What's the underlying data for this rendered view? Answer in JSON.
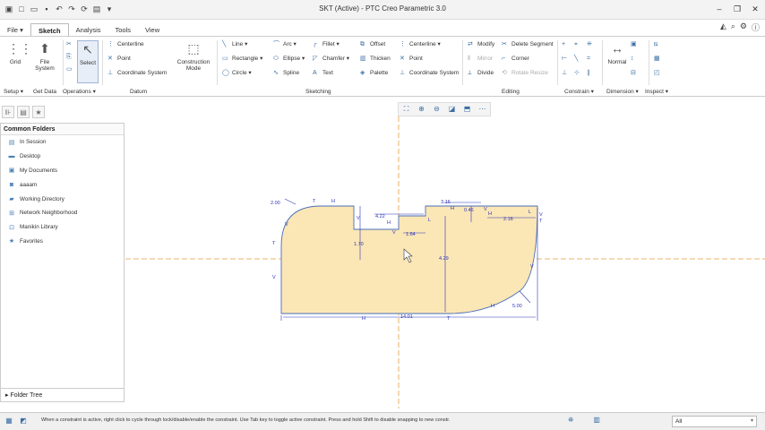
{
  "title_bar": {
    "title": "SKT (Active) - PTC Creo Parametric 3.0",
    "quick_access_icons": [
      "app-menu-icon",
      "new-icon",
      "open-icon",
      "save-icon",
      "undo-icon",
      "redo-icon",
      "regenerate-icon",
      "window-icon",
      "customize-icon"
    ],
    "window_buttons": [
      "minimize-icon",
      "restore-icon",
      "close-icon"
    ]
  },
  "ribbon_tabs": [
    "File",
    "Sketch",
    "Analysis",
    "Tools",
    "View"
  ],
  "right_icons": [
    "help-icon",
    "search-icon",
    "settings-icon",
    "info-icon"
  ],
  "ribbon": {
    "grid": "Grid",
    "file_system": "File System",
    "select": "Select",
    "construction_mode": "Construction Mode",
    "datum": {
      "centerline": "Centerline",
      "point": "Point",
      "coordinate_system": "Coordinate System"
    },
    "sketching": {
      "line": "Line",
      "rectangle": "Rectangle",
      "circle": "Circle",
      "arc": "Arc",
      "ellipse": "Ellipse",
      "spline": "Spline",
      "fillet": "Fillet",
      "chamfer": "Chamfer",
      "text": "Text",
      "offset": "Offset",
      "thicken": "Thicken",
      "palette": "Palette",
      "centerline": "Centerline",
      "point": "Point",
      "coordinate_system": "Coordinate System"
    },
    "editing": {
      "modify": "Modify",
      "mirror": "Mirror",
      "divide": "Divide",
      "delete_segment": "Delete Segment",
      "corner": "Corner",
      "rotate_resize": "Rotate Resize"
    },
    "normal": "Normal",
    "group_labels": {
      "setup": "Setup",
      "get_data": "Get Data",
      "operations": "Operations",
      "datum": "Datum",
      "sketching": "Sketching",
      "editing": "Editing",
      "constrain": "Constrain",
      "dimension": "Dimension",
      "inspect": "Inspect"
    }
  },
  "folder_panel": {
    "title": "Common Folders",
    "folders": [
      {
        "label": "In Session",
        "icon": "session-icon"
      },
      {
        "label": "Desktop",
        "icon": "desktop-icon"
      },
      {
        "label": "My Documents",
        "icon": "documents-icon"
      },
      {
        "label": "aaaam",
        "icon": "user-folder-icon"
      },
      {
        "label": "Working Directory",
        "icon": "working-directory-icon"
      },
      {
        "label": "Network Neighborhood",
        "icon": "network-icon"
      },
      {
        "label": "Manikin Library",
        "icon": "manikin-icon"
      },
      {
        "label": "Favorites",
        "icon": "favorites-icon"
      }
    ],
    "tree_label": "Folder Tree"
  },
  "sketch": {
    "dimensions": {
      "fillet_left": "2.00",
      "top_a": "4.22",
      "top_b": "3.16",
      "top_c": "0.46",
      "right_c": "2.16",
      "step_h": "1.64",
      "left_v": "1.70",
      "center_v": "4.29",
      "arc_r": "5.00",
      "total": "14.01"
    },
    "constraint_marks": [
      "T",
      "H",
      "V",
      "H",
      "V",
      "H",
      "L",
      "V",
      "H",
      "V",
      "L",
      "T",
      "V",
      "V",
      "T",
      "V",
      "H",
      "T",
      "H"
    ],
    "fill_color": "#fbe6b6",
    "outline_color": "#4a6fb5",
    "dimension_color": "#2c34b8",
    "centerline_color": "#e89a3a"
  },
  "status": {
    "message": "When a constraint is active, right click to cycle through lock/disable/enable the constraint. Use Tab key to toggle active constraint. Press and hold Shift to disable snapping to new constr.",
    "filter_value": "All"
  }
}
